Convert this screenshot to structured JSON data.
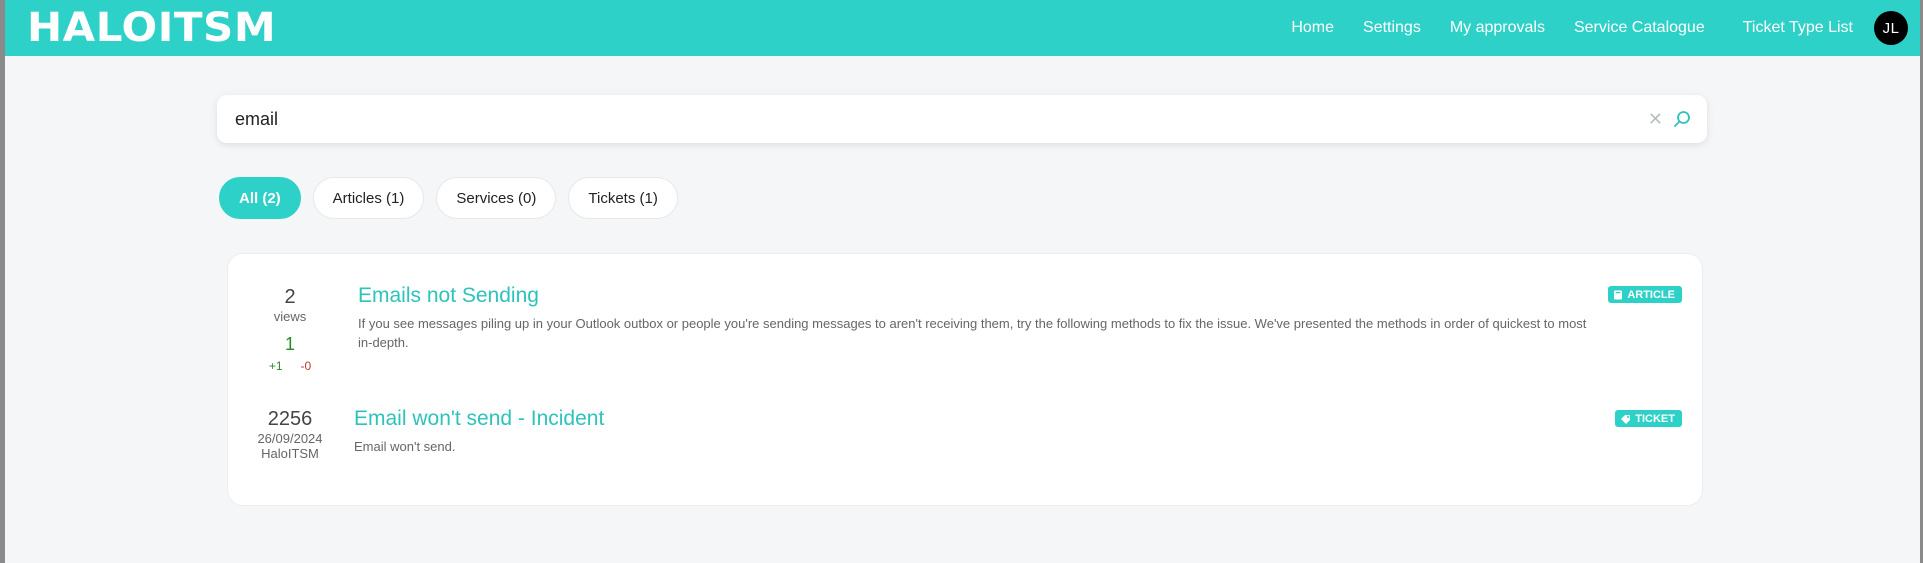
{
  "header": {
    "logo": "HALOITSM",
    "nav": {
      "home": "Home",
      "settings": "Settings",
      "approvals": "My approvals",
      "catalogue": "Service Catalogue",
      "ticket_types": "Ticket Type List"
    },
    "avatar_initials": "JL"
  },
  "search": {
    "value": "email",
    "clear_icon": "close-icon",
    "search_icon": "search-icon"
  },
  "filters": {
    "all": "All (2)",
    "articles": "Articles (1)",
    "services": "Services (0)",
    "tickets": "Tickets (1)"
  },
  "results": [
    {
      "meta_value": "2",
      "meta_label": "views",
      "rating": "1",
      "upvotes": "+1",
      "downvotes": "-0",
      "title": "Emails not Sending",
      "description": "If you see messages piling up in your Outlook outbox or people you're sending messages to aren't receiving them, try the following methods to fix the issue. We've presented the methods in order of quickest to most in-depth.",
      "tag": "ARTICLE",
      "tag_icon": "book-icon"
    },
    {
      "meta_value": "2256",
      "meta_date": "26/09/2024",
      "meta_label": "HaloITSM",
      "title": "Email won't send - Incident",
      "description": "Email won't send.",
      "tag": "TICKET",
      "tag_icon": "ticket-icon"
    }
  ],
  "colors": {
    "brand": "#2dd1c7",
    "title": "#2dc3bb",
    "upvote": "#2a8a2a",
    "downvote": "#c0392b"
  }
}
